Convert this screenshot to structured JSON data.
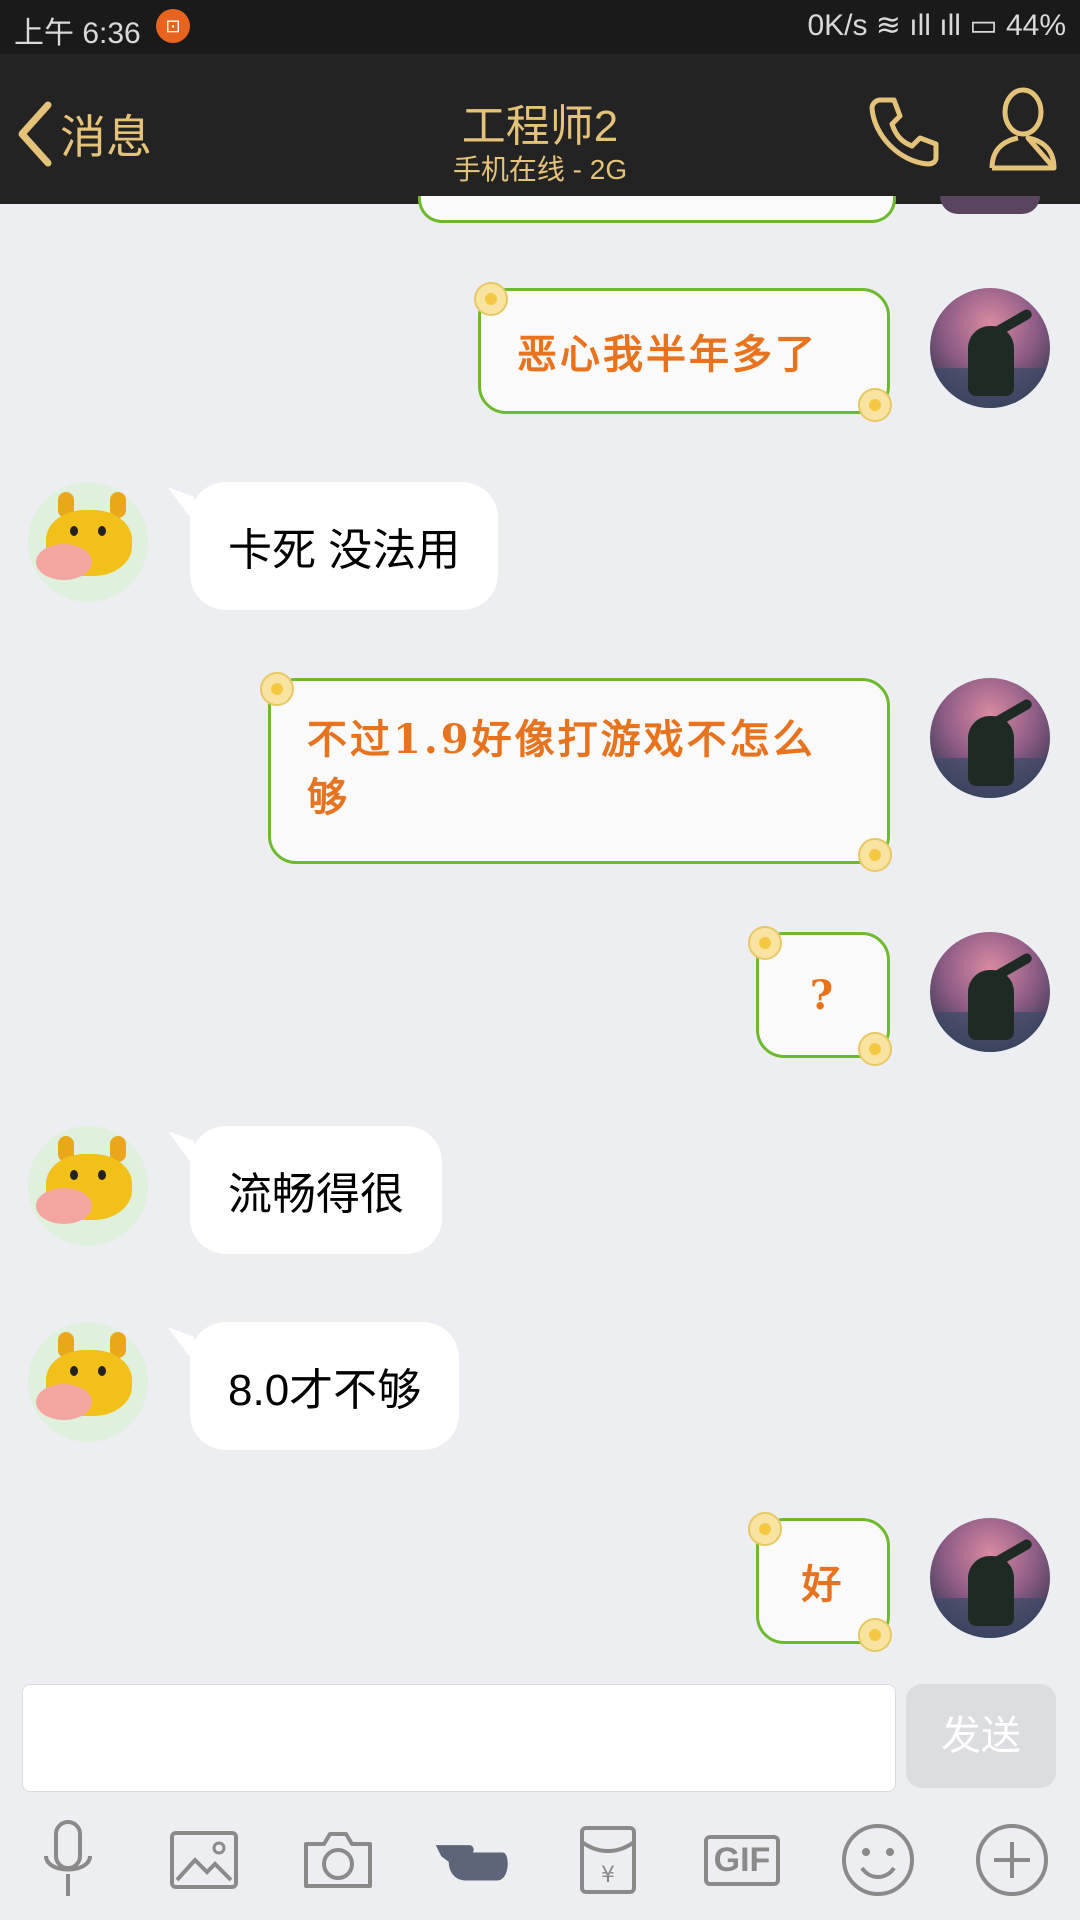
{
  "status_bar": {
    "time": "上午 6:36",
    "notification_icon": "notification-icon",
    "right_text": "0K/s  ≋ ıll ıll ▭ 44%"
  },
  "header": {
    "back_label": "消息",
    "title": "工程师2",
    "subtitle": "手机在线 - 2G"
  },
  "messages": [
    {
      "from": "me",
      "text": "恶心我半年多了"
    },
    {
      "from": "them",
      "text": "卡死 没法用"
    },
    {
      "from": "me",
      "text": "不过1.9好像打游戏不怎么够"
    },
    {
      "from": "me",
      "text": "?"
    },
    {
      "from": "them",
      "text": "流畅得很"
    },
    {
      "from": "them",
      "text": "8.0才不够"
    },
    {
      "from": "me",
      "text": "好"
    }
  ],
  "composer": {
    "input_value": "",
    "send_label": "发送"
  },
  "toolbar": {
    "gif_label": "GIF",
    "icons": [
      "microphone-icon",
      "image-icon",
      "camera-icon",
      "poke-icon",
      "red-packet-icon",
      "gif-icon",
      "emoji-icon",
      "plus-icon"
    ]
  },
  "colors": {
    "accent": "#e5c27a",
    "bubble_border": "#6dbb2c",
    "bubble_text": "#e8731e"
  }
}
